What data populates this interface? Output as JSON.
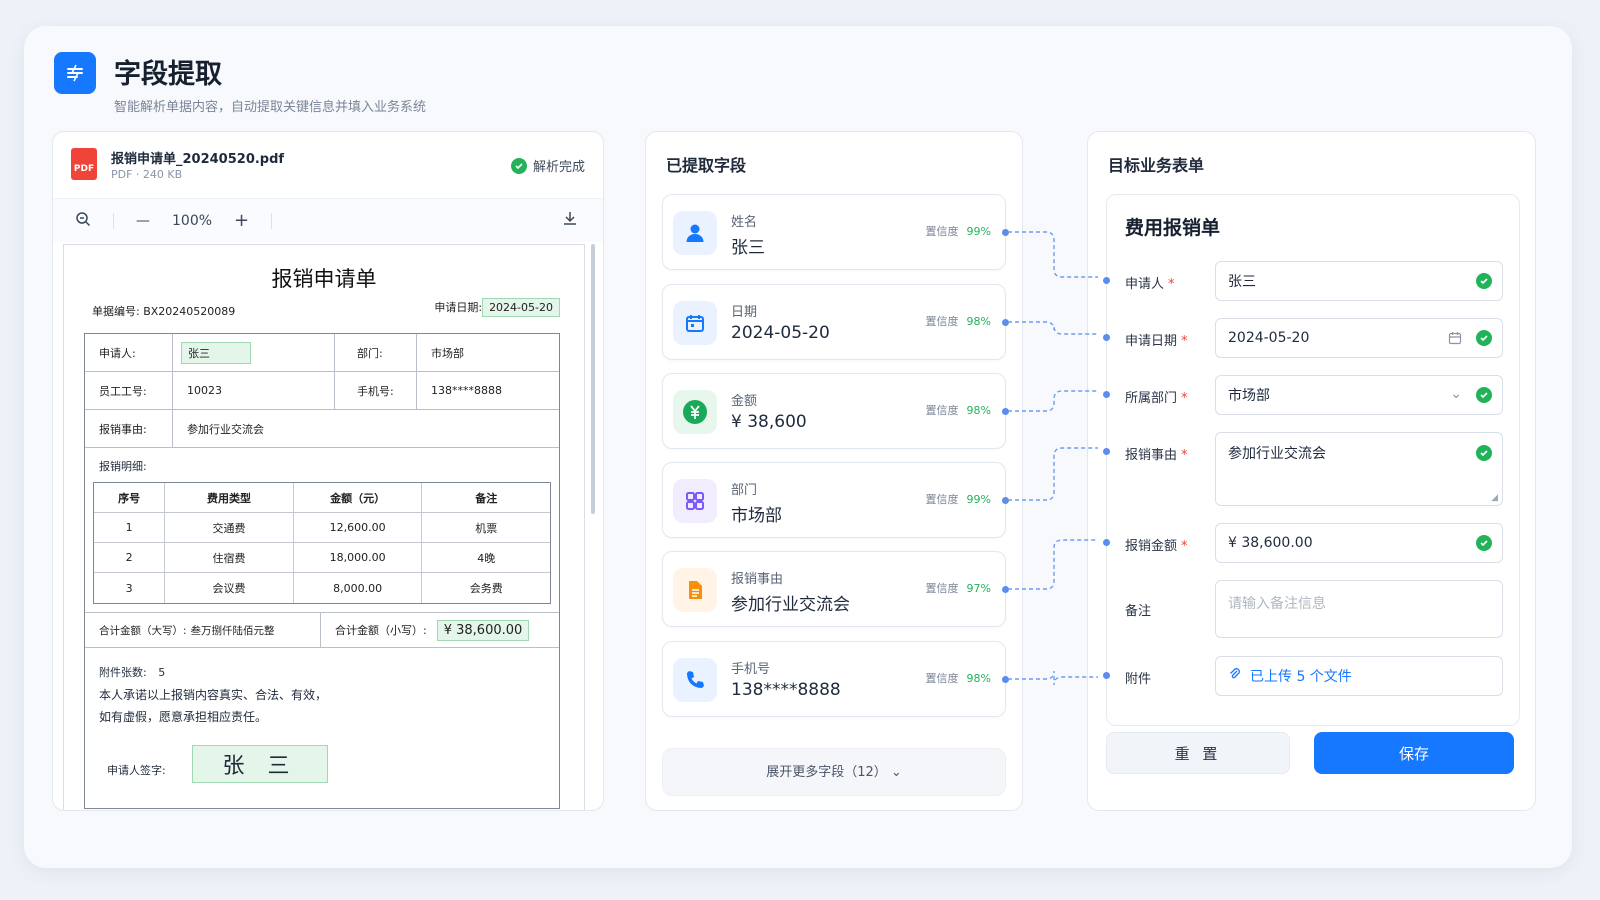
{
  "header": {
    "title": "字段提取",
    "subtitle": "智能解析单据内容，自动提取关键信息并填入业务系统",
    "icon": "extract-icon"
  },
  "file": {
    "name": "报销申请单_20240520.pdf",
    "meta": "PDF · 240 KB",
    "status": "解析完成",
    "icon_text": "PDF"
  },
  "viewer": {
    "zoom": "100%",
    "minus": "—",
    "plus": "+"
  },
  "doc": {
    "title": "报销申请单",
    "number_label": "单据编号:",
    "number": "BX20240520089",
    "date_label": "申请日期:",
    "date": "2024-05-20",
    "rows": [
      {
        "l1": "申请人:",
        "v1": "张三",
        "l2": "部门:",
        "v2": "市场部"
      },
      {
        "l1": "员工工号:",
        "v1": "10023",
        "l2": "手机号:",
        "v2": "138****8888"
      }
    ],
    "reason_label": "报销事由:",
    "reason": "参加行业交流会",
    "detail_label": "报销明细:",
    "item_headers": [
      "序号",
      "费用类型",
      "金额（元）",
      "备注"
    ],
    "items": [
      [
        "1",
        "交通费",
        "12,600.00",
        "机票"
      ],
      [
        "2",
        "住宿费",
        "18,000.00",
        "4晚"
      ],
      [
        "3",
        "会议费",
        "8,000.00",
        "会务费"
      ]
    ],
    "total_upper_label": "合计金额（大写）:",
    "total_upper": "叁万捌仟陆佰元整",
    "total_lower_label": "合计金额（小写）:",
    "total_lower": "¥ 38,600.00",
    "attach_label": "附件张数:",
    "attach_count": "5",
    "promise1": "本人承诺以上报销内容真实、合法、有效，",
    "promise2": "如有虚假，愿意承担相应责任。",
    "sign_label": "申请人签字:",
    "sign": "张 三"
  },
  "extracted": {
    "title": "已提取字段",
    "conf_label": "置信度",
    "fields": [
      {
        "label": "姓名",
        "value": "张三",
        "conf": "99%",
        "icon": "user-icon",
        "color": "#1677ff",
        "bg": "#eaf2ff"
      },
      {
        "label": "日期",
        "value": "2024-05-20",
        "conf": "98%",
        "icon": "calendar-icon",
        "color": "#1677ff",
        "bg": "#eaf2ff"
      },
      {
        "label": "金额",
        "value": "¥ 38,600",
        "conf": "98%",
        "icon": "yuan-icon",
        "color": "#1aa85a",
        "bg": "#e7f7ee"
      },
      {
        "label": "部门",
        "value": "市场部",
        "conf": "99%",
        "icon": "grid-icon",
        "color": "#7a5af8",
        "bg": "#f1edff"
      },
      {
        "label": "报销事由",
        "value": "参加行业交流会",
        "conf": "97%",
        "icon": "document-icon",
        "color": "#f79009",
        "bg": "#fff4e5"
      },
      {
        "label": "手机号",
        "value": "138****8888",
        "conf": "98%",
        "icon": "phone-icon",
        "color": "#1677ff",
        "bg": "#eaf2ff"
      }
    ],
    "more": "展开更多字段（12）"
  },
  "target": {
    "title": "目标业务表单",
    "form_title": "费用报销单",
    "fields": [
      {
        "label": "申请人",
        "value": "张三",
        "required": true
      },
      {
        "label": "申请日期",
        "value": "2024-05-20",
        "required": true
      },
      {
        "label": "所属部门",
        "value": "市场部",
        "required": true
      },
      {
        "label": "报销事由",
        "value": "参加行业交流会",
        "required": true
      },
      {
        "label": "报销金额",
        "value": "¥ 38,600.00",
        "required": true
      },
      {
        "label": "备注",
        "placeholder": "请输入备注信息",
        "required": false
      },
      {
        "label": "附件",
        "value": "已上传 5 个文件",
        "required": false
      }
    ],
    "reset": "重 置",
    "save": "保存",
    "accent": "#1677ff",
    "ok_color": "#22b35a"
  }
}
